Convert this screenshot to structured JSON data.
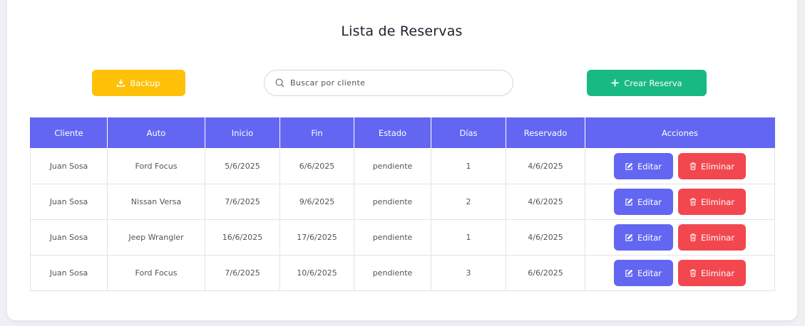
{
  "page_title": "Lista de Reservas",
  "toolbar": {
    "backup_label": "Backup",
    "backup_icon": "download-icon",
    "search_placeholder": "Buscar por cliente",
    "search_value": "",
    "create_label": "Crear Reserva",
    "create_icon": "plus-icon"
  },
  "table": {
    "headers": [
      "Cliente",
      "Auto",
      "Inicio",
      "Fin",
      "Estado",
      "Días",
      "Reservado",
      "Acciones"
    ],
    "rows": [
      {
        "cliente": "Juan Sosa",
        "auto": "Ford Focus",
        "inicio": "5/6/2025",
        "fin": "6/6/2025",
        "estado": "pendiente",
        "dias": "1",
        "reservado": "4/6/2025"
      },
      {
        "cliente": "Juan Sosa",
        "auto": "Nissan Versa",
        "inicio": "7/6/2025",
        "fin": "9/6/2025",
        "estado": "pendiente",
        "dias": "2",
        "reservado": "4/6/2025"
      },
      {
        "cliente": "Juan Sosa",
        "auto": "Jeep Wrangler",
        "inicio": "16/6/2025",
        "fin": "17/6/2025",
        "estado": "pendiente",
        "dias": "1",
        "reservado": "4/6/2025"
      },
      {
        "cliente": "Juan Sosa",
        "auto": "Ford Focus",
        "inicio": "7/6/2025",
        "fin": "10/6/2025",
        "estado": "pendiente",
        "dias": "3",
        "reservado": "6/6/2025"
      }
    ],
    "edit_label": "Editar",
    "delete_label": "Eliminar"
  },
  "colors": {
    "accent": "#6366f1",
    "backup": "#ffc107",
    "create": "#19b984",
    "delete": "#f2474f"
  }
}
